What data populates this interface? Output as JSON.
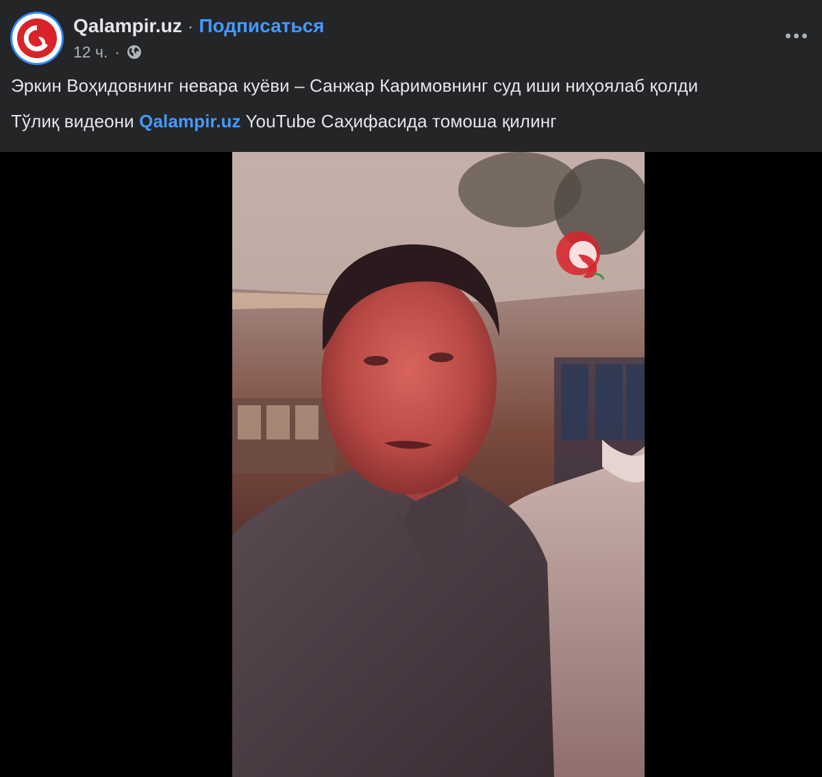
{
  "post": {
    "page_name": "Qalampir.uz",
    "separator": "·",
    "subscribe_label": "Подписаться",
    "time": "12 ч.",
    "meta_separator": "·",
    "privacy_icon": "globe-icon",
    "more_icon": "more-options-icon",
    "avatar_icon": "qalampir-logo-icon",
    "text_line_1": "Эркин Воҳидовнинг невара куёви – Санжар Каримовнинг суд иши ниҳоялаб қолди",
    "text_line_2_before": "Тўлиқ видеони",
    "text_line_2_link": "Qalampir.uz",
    "text_line_2_after": "YouTube Саҳифасида томоша қилинг"
  },
  "colors": {
    "background": "#000000",
    "header_background": "#242526",
    "primary_text": "#e4e6eb",
    "secondary_text": "#b0b3b8",
    "link_blue": "#4599ff",
    "brand_red": "#d8232a"
  },
  "video": {
    "watermark_icon": "qalampir-pepper-icon"
  }
}
